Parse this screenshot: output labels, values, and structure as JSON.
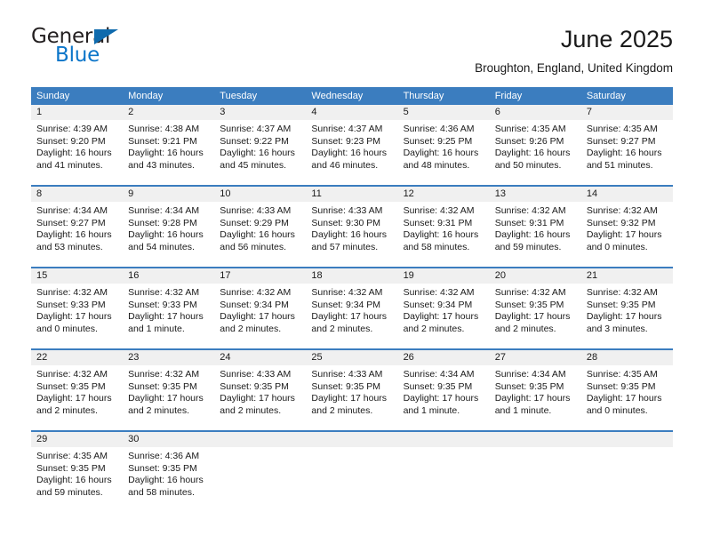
{
  "logo": {
    "primary_text": "General",
    "secondary_text": "Blue",
    "primary_color": "#231f20",
    "secondary_color": "#0b75c9",
    "triangle_color": "#0e6aad",
    "icon": "triangle-flag-icon"
  },
  "header": {
    "title": "June 2025",
    "subtitle": "Broughton, England, United Kingdom"
  },
  "theme": {
    "header_band": "#3b7dbf",
    "day_band": "#f0f0f0",
    "row_divider": "#3b7dbf",
    "text": "#1a1a1a"
  },
  "weekday_headers": [
    "Sunday",
    "Monday",
    "Tuesday",
    "Wednesday",
    "Thursday",
    "Friday",
    "Saturday"
  ],
  "weeks": [
    [
      {
        "day": "1",
        "sunrise": "Sunrise: 4:39 AM",
        "sunset": "Sunset: 9:20 PM",
        "daylight": "Daylight: 16 hours and 41 minutes."
      },
      {
        "day": "2",
        "sunrise": "Sunrise: 4:38 AM",
        "sunset": "Sunset: 9:21 PM",
        "daylight": "Daylight: 16 hours and 43 minutes."
      },
      {
        "day": "3",
        "sunrise": "Sunrise: 4:37 AM",
        "sunset": "Sunset: 9:22 PM",
        "daylight": "Daylight: 16 hours and 45 minutes."
      },
      {
        "day": "4",
        "sunrise": "Sunrise: 4:37 AM",
        "sunset": "Sunset: 9:23 PM",
        "daylight": "Daylight: 16 hours and 46 minutes."
      },
      {
        "day": "5",
        "sunrise": "Sunrise: 4:36 AM",
        "sunset": "Sunset: 9:25 PM",
        "daylight": "Daylight: 16 hours and 48 minutes."
      },
      {
        "day": "6",
        "sunrise": "Sunrise: 4:35 AM",
        "sunset": "Sunset: 9:26 PM",
        "daylight": "Daylight: 16 hours and 50 minutes."
      },
      {
        "day": "7",
        "sunrise": "Sunrise: 4:35 AM",
        "sunset": "Sunset: 9:27 PM",
        "daylight": "Daylight: 16 hours and 51 minutes."
      }
    ],
    [
      {
        "day": "8",
        "sunrise": "Sunrise: 4:34 AM",
        "sunset": "Sunset: 9:27 PM",
        "daylight": "Daylight: 16 hours and 53 minutes."
      },
      {
        "day": "9",
        "sunrise": "Sunrise: 4:34 AM",
        "sunset": "Sunset: 9:28 PM",
        "daylight": "Daylight: 16 hours and 54 minutes."
      },
      {
        "day": "10",
        "sunrise": "Sunrise: 4:33 AM",
        "sunset": "Sunset: 9:29 PM",
        "daylight": "Daylight: 16 hours and 56 minutes."
      },
      {
        "day": "11",
        "sunrise": "Sunrise: 4:33 AM",
        "sunset": "Sunset: 9:30 PM",
        "daylight": "Daylight: 16 hours and 57 minutes."
      },
      {
        "day": "12",
        "sunrise": "Sunrise: 4:32 AM",
        "sunset": "Sunset: 9:31 PM",
        "daylight": "Daylight: 16 hours and 58 minutes."
      },
      {
        "day": "13",
        "sunrise": "Sunrise: 4:32 AM",
        "sunset": "Sunset: 9:31 PM",
        "daylight": "Daylight: 16 hours and 59 minutes."
      },
      {
        "day": "14",
        "sunrise": "Sunrise: 4:32 AM",
        "sunset": "Sunset: 9:32 PM",
        "daylight": "Daylight: 17 hours and 0 minutes."
      }
    ],
    [
      {
        "day": "15",
        "sunrise": "Sunrise: 4:32 AM",
        "sunset": "Sunset: 9:33 PM",
        "daylight": "Daylight: 17 hours and 0 minutes."
      },
      {
        "day": "16",
        "sunrise": "Sunrise: 4:32 AM",
        "sunset": "Sunset: 9:33 PM",
        "daylight": "Daylight: 17 hours and 1 minute."
      },
      {
        "day": "17",
        "sunrise": "Sunrise: 4:32 AM",
        "sunset": "Sunset: 9:34 PM",
        "daylight": "Daylight: 17 hours and 2 minutes."
      },
      {
        "day": "18",
        "sunrise": "Sunrise: 4:32 AM",
        "sunset": "Sunset: 9:34 PM",
        "daylight": "Daylight: 17 hours and 2 minutes."
      },
      {
        "day": "19",
        "sunrise": "Sunrise: 4:32 AM",
        "sunset": "Sunset: 9:34 PM",
        "daylight": "Daylight: 17 hours and 2 minutes."
      },
      {
        "day": "20",
        "sunrise": "Sunrise: 4:32 AM",
        "sunset": "Sunset: 9:35 PM",
        "daylight": "Daylight: 17 hours and 2 minutes."
      },
      {
        "day": "21",
        "sunrise": "Sunrise: 4:32 AM",
        "sunset": "Sunset: 9:35 PM",
        "daylight": "Daylight: 17 hours and 3 minutes."
      }
    ],
    [
      {
        "day": "22",
        "sunrise": "Sunrise: 4:32 AM",
        "sunset": "Sunset: 9:35 PM",
        "daylight": "Daylight: 17 hours and 2 minutes."
      },
      {
        "day": "23",
        "sunrise": "Sunrise: 4:32 AM",
        "sunset": "Sunset: 9:35 PM",
        "daylight": "Daylight: 17 hours and 2 minutes."
      },
      {
        "day": "24",
        "sunrise": "Sunrise: 4:33 AM",
        "sunset": "Sunset: 9:35 PM",
        "daylight": "Daylight: 17 hours and 2 minutes."
      },
      {
        "day": "25",
        "sunrise": "Sunrise: 4:33 AM",
        "sunset": "Sunset: 9:35 PM",
        "daylight": "Daylight: 17 hours and 2 minutes."
      },
      {
        "day": "26",
        "sunrise": "Sunrise: 4:34 AM",
        "sunset": "Sunset: 9:35 PM",
        "daylight": "Daylight: 17 hours and 1 minute."
      },
      {
        "day": "27",
        "sunrise": "Sunrise: 4:34 AM",
        "sunset": "Sunset: 9:35 PM",
        "daylight": "Daylight: 17 hours and 1 minute."
      },
      {
        "day": "28",
        "sunrise": "Sunrise: 4:35 AM",
        "sunset": "Sunset: 9:35 PM",
        "daylight": "Daylight: 17 hours and 0 minutes."
      }
    ],
    [
      {
        "day": "29",
        "sunrise": "Sunrise: 4:35 AM",
        "sunset": "Sunset: 9:35 PM",
        "daylight": "Daylight: 16 hours and 59 minutes."
      },
      {
        "day": "30",
        "sunrise": "Sunrise: 4:36 AM",
        "sunset": "Sunset: 9:35 PM",
        "daylight": "Daylight: 16 hours and 58 minutes."
      },
      {
        "day": "",
        "sunrise": "",
        "sunset": "",
        "daylight": ""
      },
      {
        "day": "",
        "sunrise": "",
        "sunset": "",
        "daylight": ""
      },
      {
        "day": "",
        "sunrise": "",
        "sunset": "",
        "daylight": ""
      },
      {
        "day": "",
        "sunrise": "",
        "sunset": "",
        "daylight": ""
      },
      {
        "day": "",
        "sunrise": "",
        "sunset": "",
        "daylight": ""
      }
    ]
  ]
}
